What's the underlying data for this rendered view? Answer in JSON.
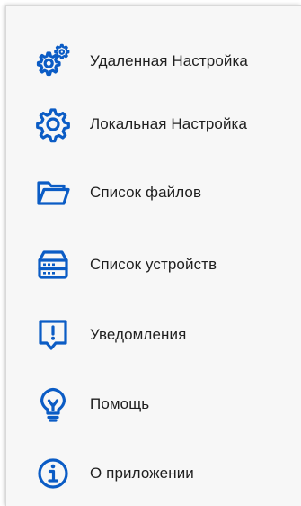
{
  "accent_color": "#0b5cc5",
  "menu": {
    "items": [
      {
        "label": "Удаленная Настройка",
        "icon": "remote-settings-gears-icon"
      },
      {
        "label": "Локальная Настройка",
        "icon": "gear-icon"
      },
      {
        "label": "Список файлов",
        "icon": "folder-icon"
      },
      {
        "label": "Список устройств",
        "icon": "server-storage-icon"
      },
      {
        "label": "Уведомления",
        "icon": "notification-exclamation-icon"
      },
      {
        "label": "Помощь",
        "icon": "lightbulb-icon"
      },
      {
        "label": "О приложении",
        "icon": "info-icon"
      }
    ]
  }
}
